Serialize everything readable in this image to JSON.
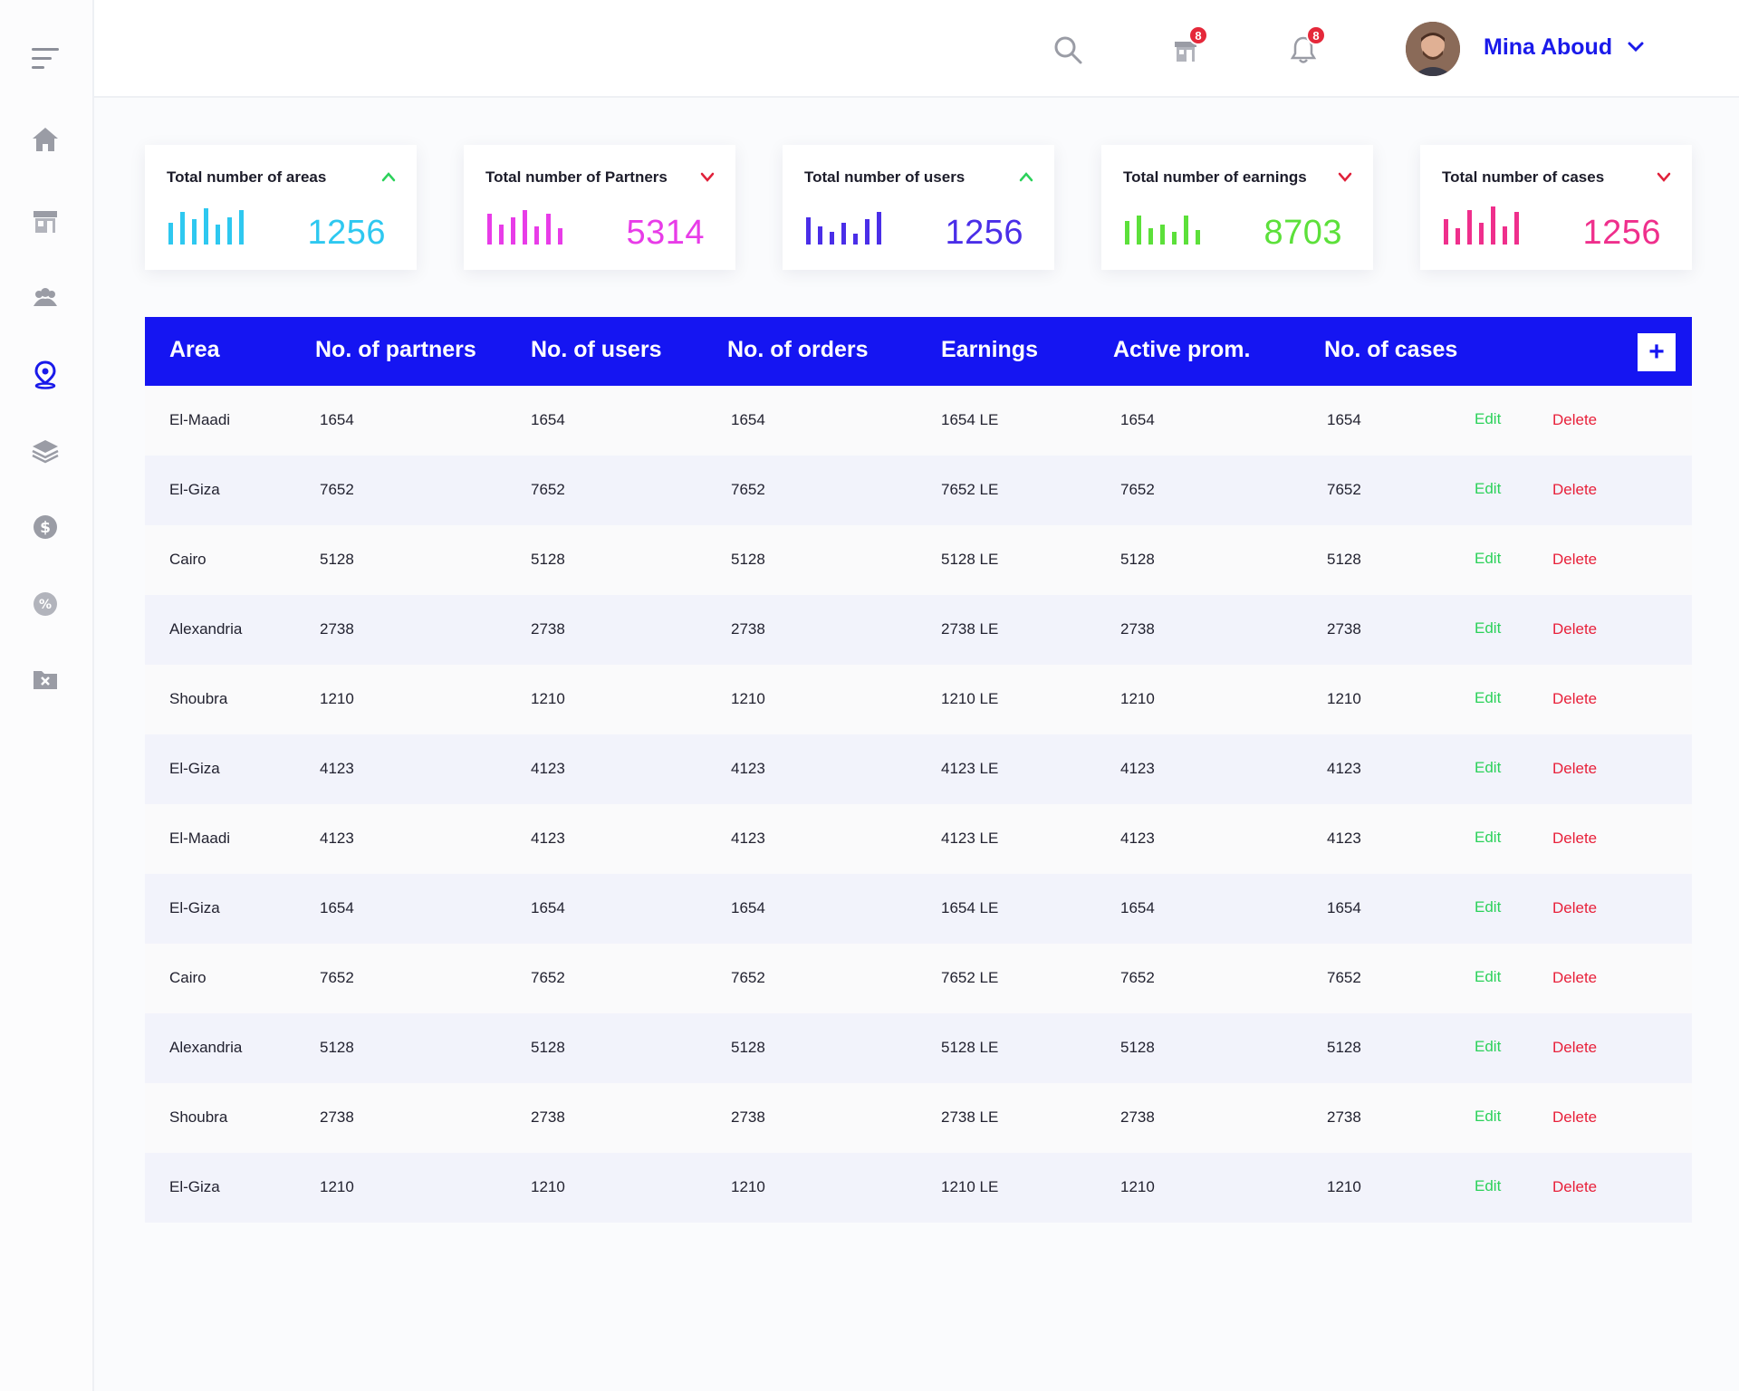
{
  "user": {
    "name": "Mina Aboud"
  },
  "badges": {
    "orders": "8",
    "notifications": "8"
  },
  "sidebar_icons": [
    "menu-icon",
    "home-icon",
    "store-icon",
    "users-group-icon",
    "map-pin-icon",
    "layers-icon",
    "dollar-icon",
    "percent-icon",
    "folder-x-icon"
  ],
  "colors": {
    "primary": "#1515f2",
    "edit": "#2bd15a",
    "delete": "#e8203a",
    "badge": "#e5283a"
  },
  "cards": [
    {
      "title": "Total number of areas",
      "value": "1256",
      "trend": "up",
      "color": "#2ec8f0"
    },
    {
      "title": "Total number of Partners",
      "value": "5314",
      "trend": "down",
      "color": "#e83ce8"
    },
    {
      "title": "Total number of users",
      "value": "1256",
      "trend": "up",
      "color": "#4a2ee8"
    },
    {
      "title": "Total number of earnings",
      "value": "8703",
      "trend": "down",
      "color": "#5ce03a"
    },
    {
      "title": "Total number of cases",
      "value": "1256",
      "trend": "down",
      "color": "#ef2f8c"
    }
  ],
  "table": {
    "headers": [
      "Area",
      "No. of partners",
      "No. of users",
      "No. of orders",
      "Earnings",
      "Active prom.",
      "No. of cases"
    ],
    "add_label": "+",
    "edit_label": "Edit",
    "delete_label": "Delete",
    "rows": [
      [
        "El-Maadi",
        "1654",
        "1654",
        "1654",
        "1654 LE",
        "1654",
        "1654"
      ],
      [
        "El-Giza",
        "7652",
        "7652",
        "7652",
        "7652 LE",
        "7652",
        "7652"
      ],
      [
        "Cairo",
        "5128",
        "5128",
        "5128",
        "5128 LE",
        "5128",
        "5128"
      ],
      [
        "Alexandria",
        "2738",
        "2738",
        "2738",
        "2738 LE",
        "2738",
        "2738"
      ],
      [
        "Shoubra",
        "1210",
        "1210",
        "1210",
        "1210 LE",
        "1210",
        "1210"
      ],
      [
        "El-Giza",
        "4123",
        "4123",
        "4123",
        "4123 LE",
        "4123",
        "4123"
      ],
      [
        "El-Maadi",
        "4123",
        "4123",
        "4123",
        "4123 LE",
        "4123",
        "4123"
      ],
      [
        "El-Giza",
        "1654",
        "1654",
        "1654",
        "1654 LE",
        "1654",
        "1654"
      ],
      [
        "Cairo",
        "7652",
        "7652",
        "7652",
        "7652 LE",
        "7652",
        "7652"
      ],
      [
        "Alexandria",
        "5128",
        "5128",
        "5128",
        "5128 LE",
        "5128",
        "5128"
      ],
      [
        "Shoubra",
        "2738",
        "2738",
        "2738",
        "2738 LE",
        "2738",
        "2738"
      ],
      [
        "El-Giza",
        "1210",
        "1210",
        "1210",
        "1210 LE",
        "1210",
        "1210"
      ]
    ]
  }
}
